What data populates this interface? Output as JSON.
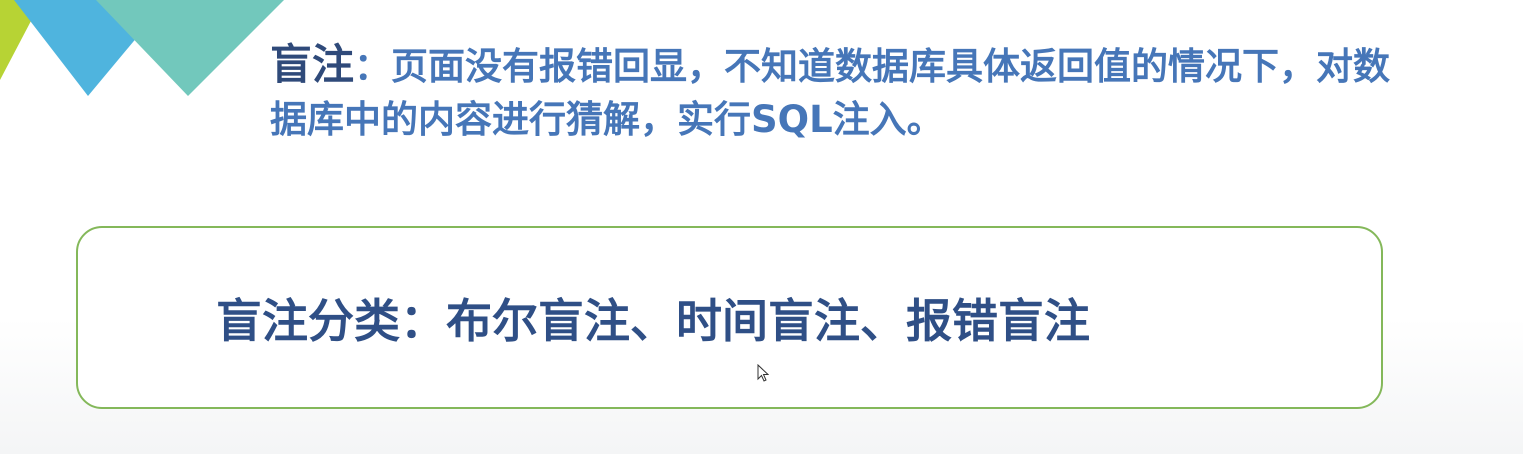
{
  "definition": {
    "term": "盲注",
    "colon": "：",
    "text": "页面没有报错回显，不知道数据库具体返回值的情况下，对数据库中的内容进行猜解，实行SQL注入。"
  },
  "classification": {
    "text": "盲注分类：布尔盲注、时间盲注、报错盲注"
  },
  "colors": {
    "deco_green": "#b7d334",
    "deco_blue": "#4fb4de",
    "deco_teal": "#72c8bc",
    "term": "#2f4a7a",
    "body_text": "#4676b8",
    "box_border": "#84b85a",
    "box_text": "#2f4f86"
  },
  "icons": {
    "cursor": "mouse-pointer-icon"
  }
}
